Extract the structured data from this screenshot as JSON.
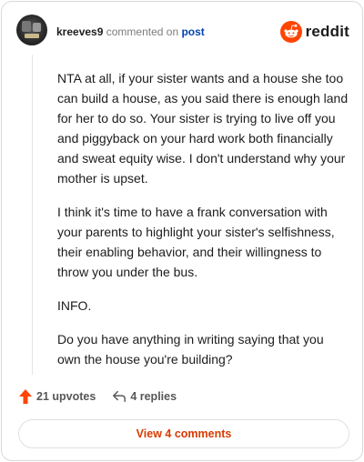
{
  "comment": {
    "username": "kreeves9",
    "verb": "commented on",
    "target": "post",
    "paragraphs": [
      "NTA at all, if your sister wants and a house she too can build a house, as you said there is enough land for her to do so. Your sister is trying to live off you and piggyback on your hard work both financially and sweat equity wise. I don't understand why your mother is upset.",
      "I think it's time to have a frank conversation with your parents to highlight your sister's selfishness, their enabling behavior, and their willingness to throw you under the bus.",
      "INFO.",
      "Do you have anything in writing saying that you own the house you're building?"
    ]
  },
  "brand": {
    "name": "reddit",
    "icon": "reddit-snoo-icon",
    "color": "#ff4500"
  },
  "actions": {
    "upvotes": "21 upvotes",
    "replies": "4 replies",
    "upvote_icon": "upvote-arrow-icon",
    "reply_icon": "reply-arrow-icon",
    "upvote_color": "#ff4500"
  },
  "footer": {
    "view_comments": "View 4 comments",
    "color": "#d93a00"
  }
}
